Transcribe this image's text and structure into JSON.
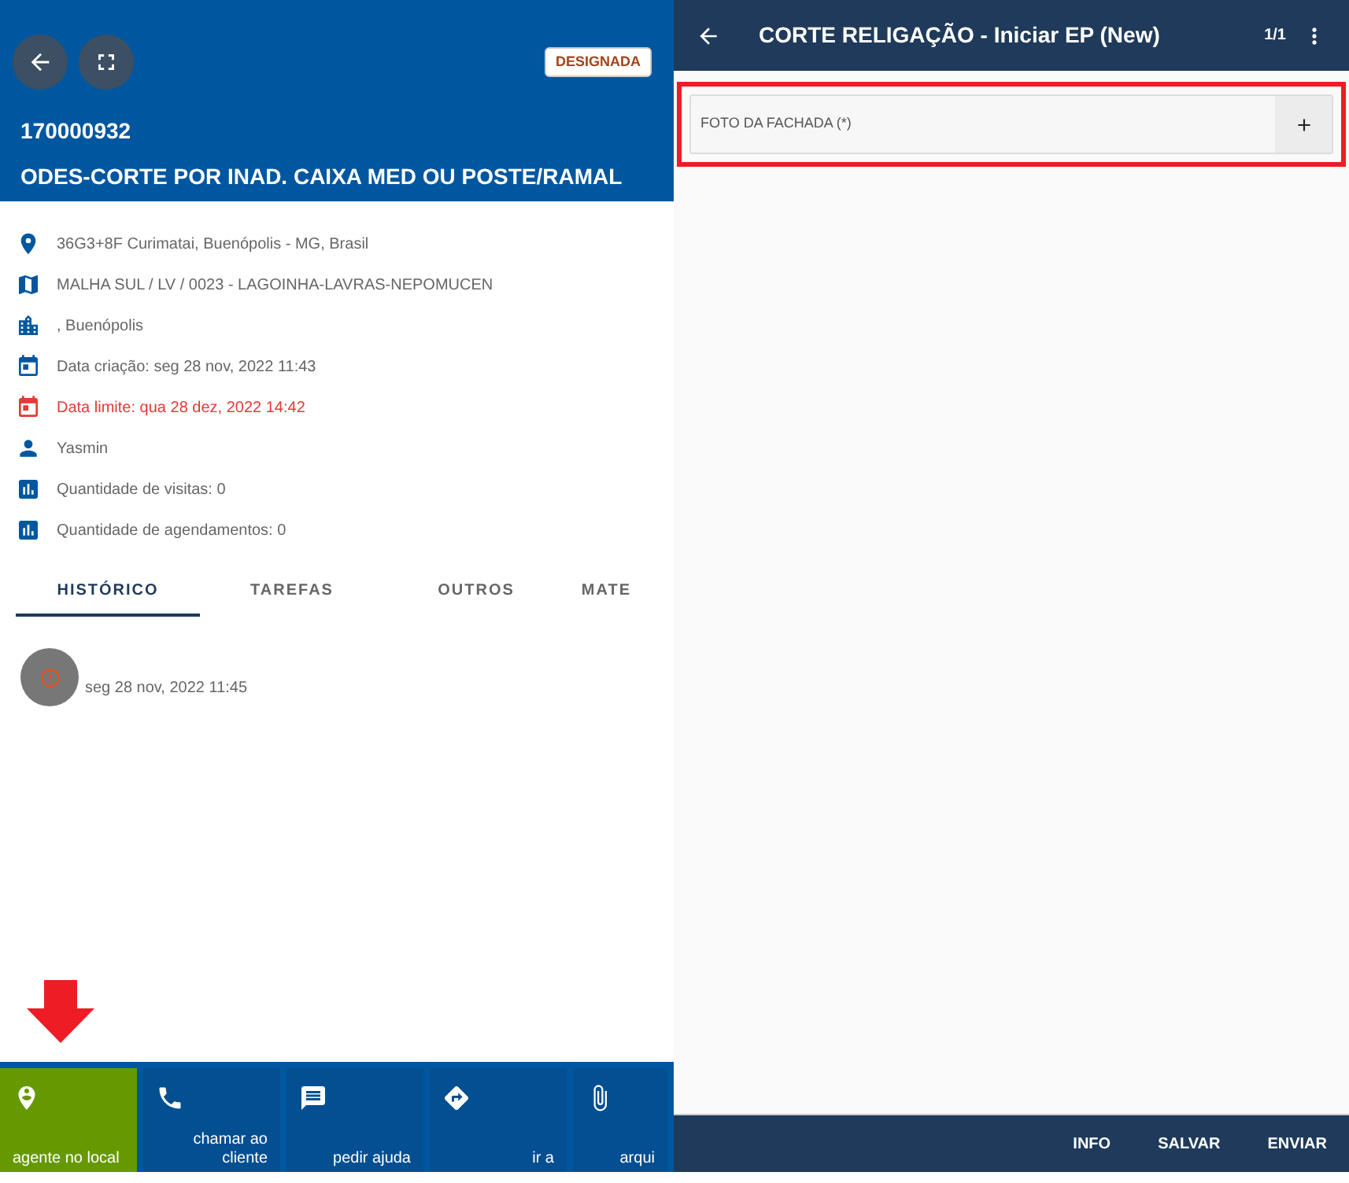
{
  "left_panel": {
    "header": {
      "status_badge": "DESIGNADA",
      "order_number": "170000932",
      "order_title": "ODES-CORTE POR INAD. CAIXA MED OU POSTE/RAMAL"
    },
    "info_rows": [
      {
        "kind": "location",
        "text": "36G3+8F Curimatai, Buenópolis - MG, Brasil",
        "alert": false
      },
      {
        "kind": "map",
        "text": "MALHA SUL / LV / 0023 - LAGOINHA-LAVRAS-NEPOMUCEN",
        "alert": false
      },
      {
        "kind": "city",
        "text": ", Buenópolis",
        "alert": false
      },
      {
        "kind": "date",
        "text": "Data criação: seg 28 nov, 2022 11:43",
        "alert": false
      },
      {
        "kind": "date",
        "text": "Data limite: qua 28 dez, 2022 14:42",
        "alert": true
      },
      {
        "kind": "person",
        "text": "Yasmin",
        "alert": false
      },
      {
        "kind": "stats",
        "text": "Quantidade de visitas: 0",
        "alert": false
      },
      {
        "kind": "stats",
        "text": "Quantidade de agendamentos: 0",
        "alert": false
      }
    ],
    "tabs": [
      {
        "label": "HISTÓRICO",
        "selected": true
      },
      {
        "label": "TAREFAS",
        "selected": false
      },
      {
        "label": "OUTROS",
        "selected": false
      },
      {
        "label": "MATE",
        "selected": false
      }
    ],
    "history": [
      {
        "time": "seg 28 nov, 2022 11:45"
      }
    ],
    "actions": [
      {
        "kind": "arrival",
        "label": "agente no local",
        "selected": true
      },
      {
        "kind": "call",
        "label": "chamar ao\ncliente",
        "selected": false
      },
      {
        "kind": "help",
        "label": "pedir ajuda",
        "selected": false
      },
      {
        "kind": "directions",
        "label": "ir a",
        "selected": false
      },
      {
        "kind": "attach",
        "label": "arqui",
        "selected": false
      }
    ]
  },
  "right_panel": {
    "title": "CORTE RELIGAÇÃO - Iniciar EP (New)",
    "page": "1/1",
    "fields": [
      {
        "label": "FOTO DA FACHADA (*)",
        "highlighted": true
      }
    ],
    "footer_buttons": [
      "INFO",
      "SALVAR",
      "ENVIAR"
    ]
  }
}
